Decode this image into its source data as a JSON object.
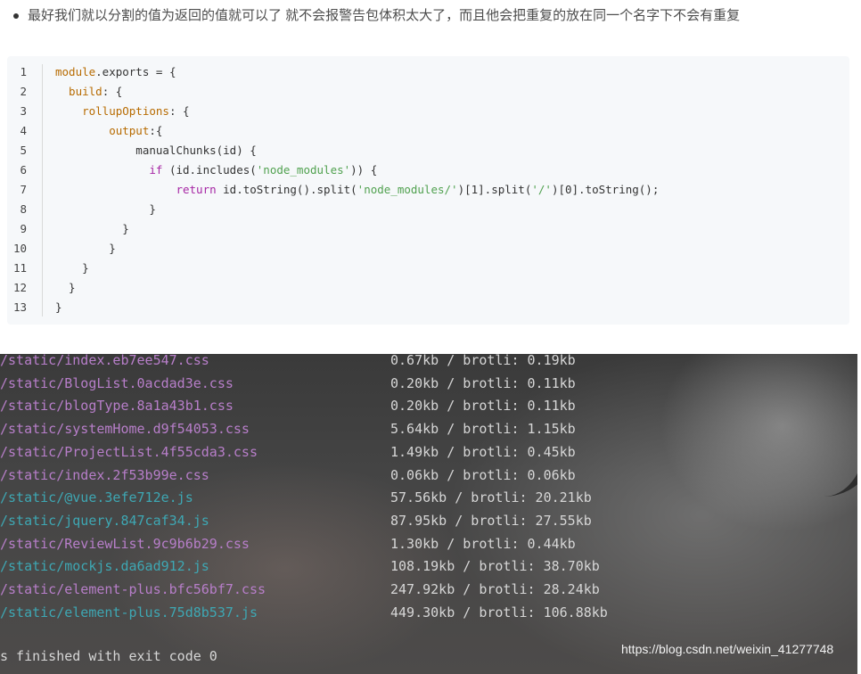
{
  "article": {
    "bullet_text": "最好我们就以分割的值为返回的值就可以了 就不会报警告包体积太大了，而且他会把重复的放在同一个名字下不会有重复"
  },
  "code": {
    "line_numbers": [
      "1",
      "2",
      "3",
      "4",
      "5",
      "6",
      "7",
      "8",
      "9",
      "10",
      "11",
      "12",
      "13"
    ],
    "lines": [
      [
        {
          "t": "module",
          "c": "prop"
        },
        {
          "t": ".exports = {",
          "c": "fn"
        }
      ],
      [
        {
          "t": "  build",
          "c": "prop"
        },
        {
          "t": ": {",
          "c": "fn"
        }
      ],
      [
        {
          "t": "    rollupOptions",
          "c": "prop"
        },
        {
          "t": ": {",
          "c": "fn"
        }
      ],
      [
        {
          "t": "        output",
          "c": "prop"
        },
        {
          "t": ":{",
          "c": "fn"
        }
      ],
      [
        {
          "t": "            manualChunks(id) {",
          "c": "fn"
        }
      ],
      [
        {
          "t": "              if",
          "c": "kw"
        },
        {
          "t": " (id.includes(",
          "c": "fn"
        },
        {
          "t": "'node_modules'",
          "c": "str"
        },
        {
          "t": ")) {",
          "c": "fn"
        }
      ],
      [
        {
          "t": "                  return",
          "c": "kw"
        },
        {
          "t": " id.toString().split(",
          "c": "fn"
        },
        {
          "t": "'node_modules/'",
          "c": "str"
        },
        {
          "t": ")[1].split(",
          "c": "fn"
        },
        {
          "t": "'/'",
          "c": "str"
        },
        {
          "t": ")[0].toString();",
          "c": "fn"
        }
      ],
      [
        {
          "t": "              }",
          "c": "fn"
        }
      ],
      [
        {
          "t": "          }",
          "c": "fn"
        }
      ],
      [
        {
          "t": "        }",
          "c": "fn"
        }
      ],
      [
        {
          "t": "    }",
          "c": "fn"
        }
      ],
      [
        {
          "t": "  }",
          "c": "fn"
        }
      ],
      [
        {
          "t": "}",
          "c": "fn"
        }
      ]
    ]
  },
  "terminal": {
    "rows": [
      {
        "file": "/static/index.eb7ee547.css",
        "type": "css",
        "size": "0.67kb / brotli: 0.19kb"
      },
      {
        "file": "/static/BlogList.0acdad3e.css",
        "type": "css",
        "size": "0.20kb / brotli: 0.11kb"
      },
      {
        "file": "/static/blogType.8a1a43b1.css",
        "type": "css",
        "size": "0.20kb / brotli: 0.11kb"
      },
      {
        "file": "/static/systemHome.d9f54053.css",
        "type": "css",
        "size": "5.64kb / brotli: 1.15kb"
      },
      {
        "file": "/static/ProjectList.4f55cda3.css",
        "type": "css",
        "size": "1.49kb / brotli: 0.45kb"
      },
      {
        "file": "/static/index.2f53b99e.css",
        "type": "css",
        "size": "0.06kb / brotli: 0.06kb"
      },
      {
        "file": "/static/@vue.3efe712e.js",
        "type": "js",
        "size": "57.56kb / brotli: 20.21kb"
      },
      {
        "file": "/static/jquery.847caf34.js",
        "type": "js",
        "size": "87.95kb / brotli: 27.55kb"
      },
      {
        "file": "/static/ReviewList.9c9b6b29.css",
        "type": "css",
        "size": "1.30kb / brotli: 0.44kb"
      },
      {
        "file": "/static/mockjs.da6ad912.js",
        "type": "js",
        "size": "108.19kb / brotli: 38.70kb"
      },
      {
        "file": "/static/element-plus.bfc56bf7.css",
        "type": "css",
        "size": "247.92kb / brotli: 28.24kb"
      },
      {
        "file": "/static/element-plus.75d8b537.js",
        "type": "js",
        "size": "449.30kb / brotli: 106.88kb"
      }
    ],
    "exit_text": "s finished with exit code 0",
    "watermark": "https://blog.csdn.net/weixin_41277748"
  },
  "colors": {
    "css_file": "#b77ec9",
    "js_file": "#3ea7b3",
    "keyword": "#a626a4",
    "string": "#50a14f",
    "property": "#b76b01"
  }
}
